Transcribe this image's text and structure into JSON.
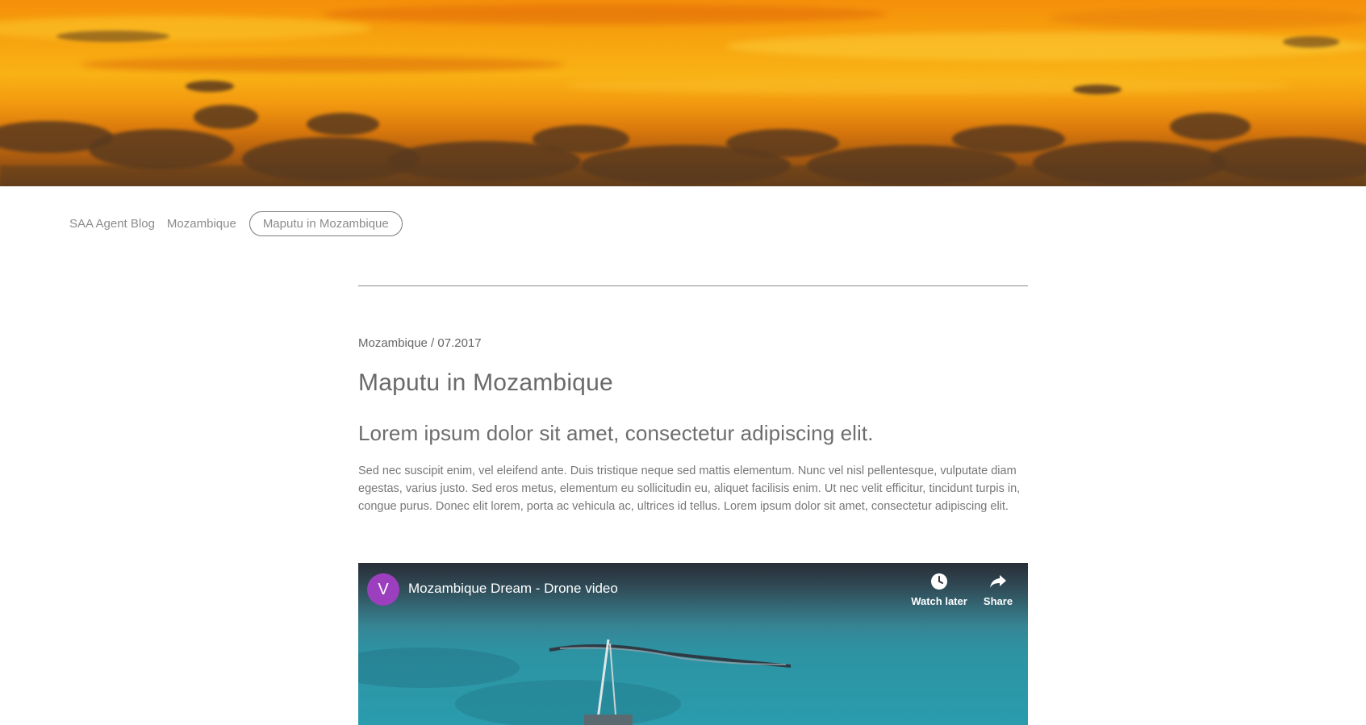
{
  "breadcrumb": {
    "items": [
      "SAA Agent Blog",
      "Mozambique"
    ],
    "current": "Maputu in Mozambique"
  },
  "article": {
    "meta": "Mozambique / 07.2017",
    "title": "Maputu in Mozambique",
    "lead": "Lorem ipsum dolor sit amet, consectetur adipiscing elit.",
    "body": "Sed nec suscipit enim, vel eleifend ante. Duis tristique neque sed mattis elementum. Nunc vel nisl pellentesque, vulputate diam egestas, varius justo. Sed eros metus, elementum eu sollicitudin eu, aliquet facilisis enim. Ut nec velit efficitur, tincidunt turpis in, congue purus. Donec elit lorem, porta ac vehicula ac, ultrices id tellus. Lorem ipsum dolor sit amet, consectetur adipiscing elit."
  },
  "video": {
    "channel_initial": "V",
    "title": "Mozambique Dream - Drone video",
    "watch_later_label": "Watch later",
    "share_label": "Share",
    "icons": [
      "clock-icon",
      "share-arrow-icon"
    ],
    "avatar_color": "#9c3fbf"
  },
  "colors": {
    "sky_top": "#f58f0a",
    "sky_mid": "#f9b214",
    "cloud": "#5a3a1e",
    "text": "#6b6b6b"
  }
}
